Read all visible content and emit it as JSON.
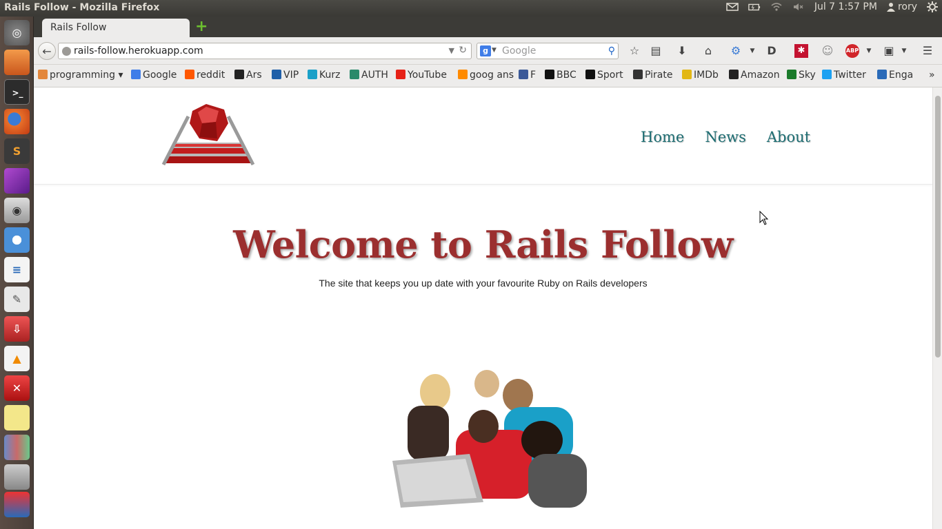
{
  "os": {
    "window_title": "Rails Follow - Mozilla Firefox",
    "clock": "Jul 7  1:57 PM",
    "user": "rory"
  },
  "browser": {
    "tab_title": "Rails Follow",
    "url": "rails-follow.herokuapp.com",
    "search_placeholder": "Google",
    "bookmarks": [
      "programming",
      "Google",
      "reddit",
      "Ars",
      "VIP",
      "Kurz",
      "AUTH",
      "YouTube",
      "goog ans",
      "F",
      "BBC",
      "Sport",
      "Pirate",
      "IMDb",
      "Amazon",
      "Sky",
      "Twitter",
      "Enga"
    ],
    "more_bookmarks": "»"
  },
  "site": {
    "nav": [
      "Home",
      "News",
      "About"
    ],
    "title": "Welcome to Rails Follow",
    "subtitle": "The site that keeps you up date with your favourite Ruby on Rails developers"
  },
  "colors": {
    "title": "#9b2f2f",
    "nav": "#1e6e73",
    "launcher": "#4f433c"
  }
}
